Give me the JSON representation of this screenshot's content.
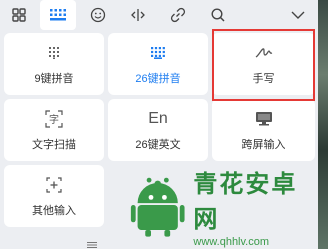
{
  "toolbar": {
    "icons": [
      "grid-menu-icon",
      "keypad-icon",
      "emoji-icon",
      "cursor-move-icon",
      "link-icon",
      "search-icon",
      "chevron-down-icon"
    ]
  },
  "tiles": {
    "nine_key_pinyin": "9键拼音",
    "twentysix_key_pinyin": "26键拼音",
    "handwriting": "手写",
    "text_scan": "文字扫描",
    "twentysix_key_english": "26键英文",
    "cross_screen_input": "跨屏输入",
    "other_input": "其他输入"
  },
  "icon_glyphs": {
    "en": "En",
    "scan": "字"
  },
  "watermark": {
    "main": "青花安卓网",
    "sub": "www.qhhlv.com"
  },
  "colors": {
    "accent": "#1e7df0",
    "highlight": "#e53935",
    "panel_bg": "#eceef2",
    "watermark_green": "#2d8a3e"
  }
}
